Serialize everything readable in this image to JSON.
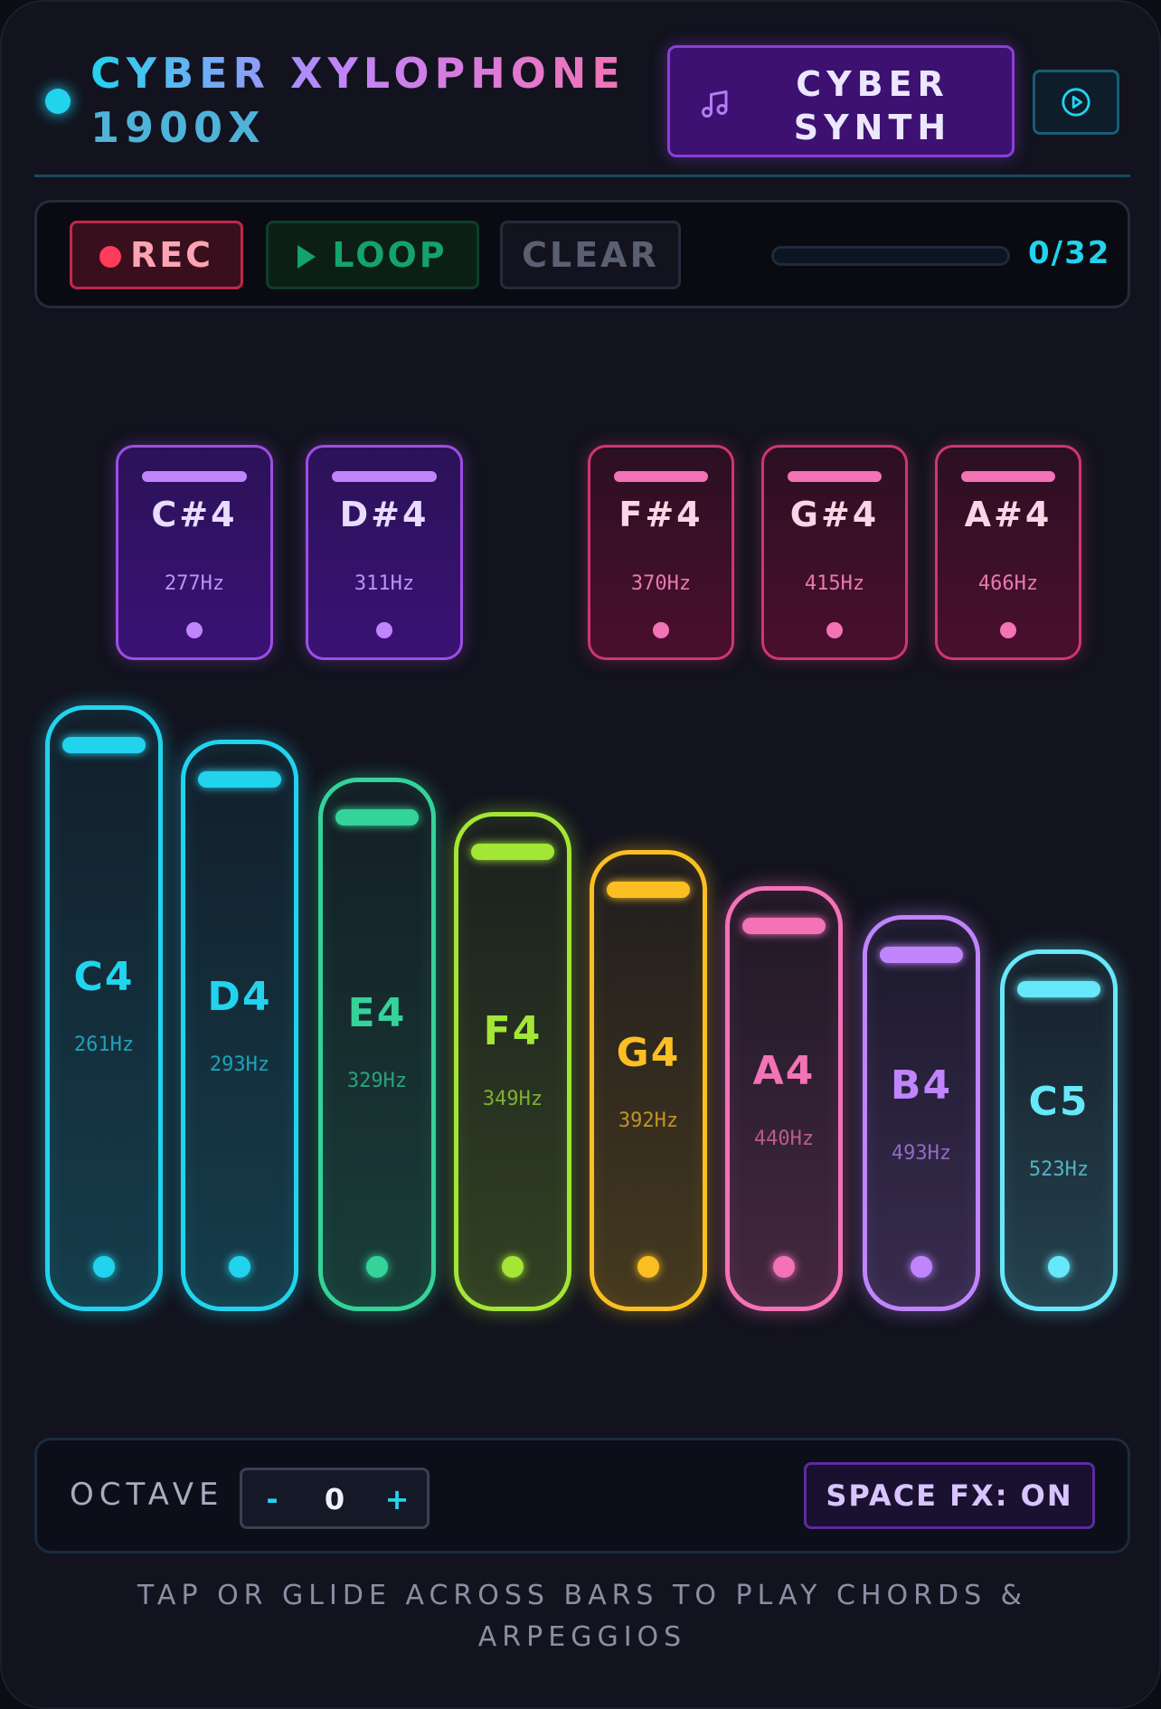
{
  "header": {
    "title_line1": "CYBER XYLOPHONE",
    "title_line2": "1900X",
    "preset_label": "CYBER SYNTH",
    "preset_icon": "music-note-icon",
    "play_icon": "play-circle-icon"
  },
  "recorder": {
    "rec_label": "REC",
    "loop_label": "LOOP",
    "clear_label": "CLEAR",
    "steps_recorded": 0,
    "steps_total": 32,
    "counter_text": "0/32"
  },
  "sharp_keys": [
    {
      "note": "C#4",
      "freq": "277Hz",
      "color": "purple"
    },
    {
      "note": "D#4",
      "freq": "311Hz",
      "color": "purple"
    },
    {
      "note": "F#4",
      "freq": "370Hz",
      "color": "pink"
    },
    {
      "note": "G#4",
      "freq": "415Hz",
      "color": "pink"
    },
    {
      "note": "A#4",
      "freq": "466Hz",
      "color": "pink"
    }
  ],
  "natural_keys": [
    {
      "note": "C4",
      "freq": "261Hz",
      "color": "#22d3ee"
    },
    {
      "note": "D4",
      "freq": "293Hz",
      "color": "#22d3ee"
    },
    {
      "note": "E4",
      "freq": "329Hz",
      "color": "#34d399"
    },
    {
      "note": "F4",
      "freq": "349Hz",
      "color": "#a3e635"
    },
    {
      "note": "G4",
      "freq": "392Hz",
      "color": "#fbbf24"
    },
    {
      "note": "A4",
      "freq": "440Hz",
      "color": "#f472b6"
    },
    {
      "note": "B4",
      "freq": "493Hz",
      "color": "#c084fc"
    },
    {
      "note": "C5",
      "freq": "523Hz",
      "color": "#67e8f9"
    }
  ],
  "controls": {
    "octave_label": "OCTAVE",
    "octave_minus": "-",
    "octave_value": "0",
    "octave_plus": "+",
    "space_fx_label": "SPACE FX: ON"
  },
  "hint": "TAP OR GLIDE ACROSS BARS TO PLAY CHORDS & ARPEGGIOS"
}
